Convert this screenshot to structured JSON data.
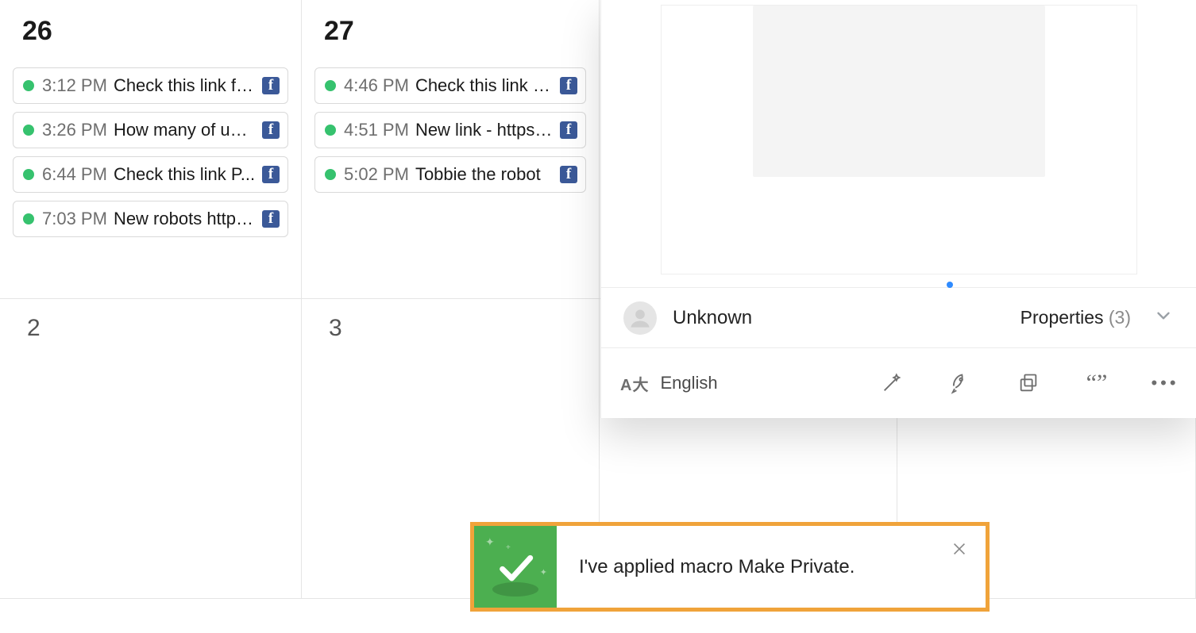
{
  "calendar": {
    "cells": [
      {
        "day": "26",
        "big": true,
        "events": [
          {
            "time": "3:12 PM",
            "title": "Check this link for...",
            "icon": "facebook",
            "status_color": "#36c26e"
          },
          {
            "time": "3:26 PM",
            "title": "How many of us ...",
            "icon": "facebook",
            "status_color": "#36c26e"
          },
          {
            "time": "6:44 PM",
            "title": "Check this link P...",
            "icon": "facebook",
            "status_color": "#36c26e"
          },
          {
            "time": "7:03 PM",
            "title": "New robots https...",
            "icon": "facebook",
            "status_color": "#36c26e"
          }
        ]
      },
      {
        "day": "27",
        "big": true,
        "events": [
          {
            "time": "4:46 PM",
            "title": "Check this link a...",
            "icon": "facebook",
            "status_color": "#36c26e"
          },
          {
            "time": "4:51 PM",
            "title": "New link - https://...",
            "icon": "facebook",
            "status_color": "#36c26e"
          },
          {
            "time": "5:02 PM",
            "title": "Tobbie the robot",
            "icon": "facebook",
            "status_color": "#36c26e"
          }
        ]
      },
      {
        "day": "",
        "big": false,
        "events": []
      },
      {
        "day": "",
        "big": false,
        "events": []
      },
      {
        "day": "2",
        "big": false,
        "events": []
      },
      {
        "day": "3",
        "big": false,
        "events": []
      },
      {
        "day": "",
        "big": false,
        "events": []
      },
      {
        "day": "",
        "big": false,
        "events": []
      }
    ]
  },
  "panel": {
    "author": "Unknown",
    "properties_label": "Properties",
    "properties_count": "(3)",
    "language": "English",
    "tools": [
      "magic-wand",
      "rocket",
      "copy-layers",
      "quote",
      "more"
    ]
  },
  "toast": {
    "message": "I've applied macro Make Private.",
    "highlight_color": "#f0a33a",
    "success_color": "#4caf50"
  }
}
